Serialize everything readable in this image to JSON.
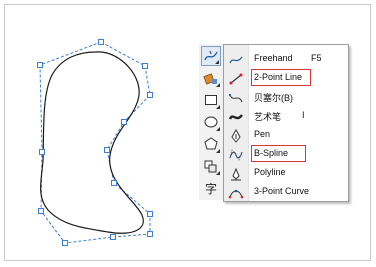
{
  "menu": {
    "items": [
      {
        "label": "Freehand",
        "shortcut": "F5",
        "icon": "freehand-icon",
        "highlighted": false
      },
      {
        "label": "2-Point Line",
        "shortcut": "",
        "icon": "two-point-line-icon",
        "highlighted": true
      },
      {
        "label": "贝塞尔(B)",
        "shortcut": "",
        "icon": "bezier-icon",
        "highlighted": false
      },
      {
        "label": "艺术笔",
        "shortcut": "I",
        "icon": "artistic-media-icon",
        "highlighted": false
      },
      {
        "label": "Pen",
        "shortcut": "",
        "icon": "pen-icon",
        "highlighted": false
      },
      {
        "label": "B-Spline",
        "shortcut": "",
        "icon": "b-spline-icon",
        "highlighted": true
      },
      {
        "label": "Polyline",
        "shortcut": "",
        "icon": "polyline-icon",
        "highlighted": false
      },
      {
        "label": "3-Point Curve",
        "shortcut": "",
        "icon": "three-point-curve-icon",
        "highlighted": false
      }
    ]
  },
  "toolbox": {
    "tools": [
      "curve-tool-icon",
      "smart-fill-icon",
      "rectangle-tool-icon",
      "ellipse-tool-icon",
      "polygon-tool-icon",
      "basic-shapes-icon",
      "text-tool-icon"
    ],
    "text_tool_glyph": "字"
  },
  "colors": {
    "highlight": "#d9383a",
    "control_lines": "#3b7fd4",
    "curve": "#1a1a1a"
  }
}
